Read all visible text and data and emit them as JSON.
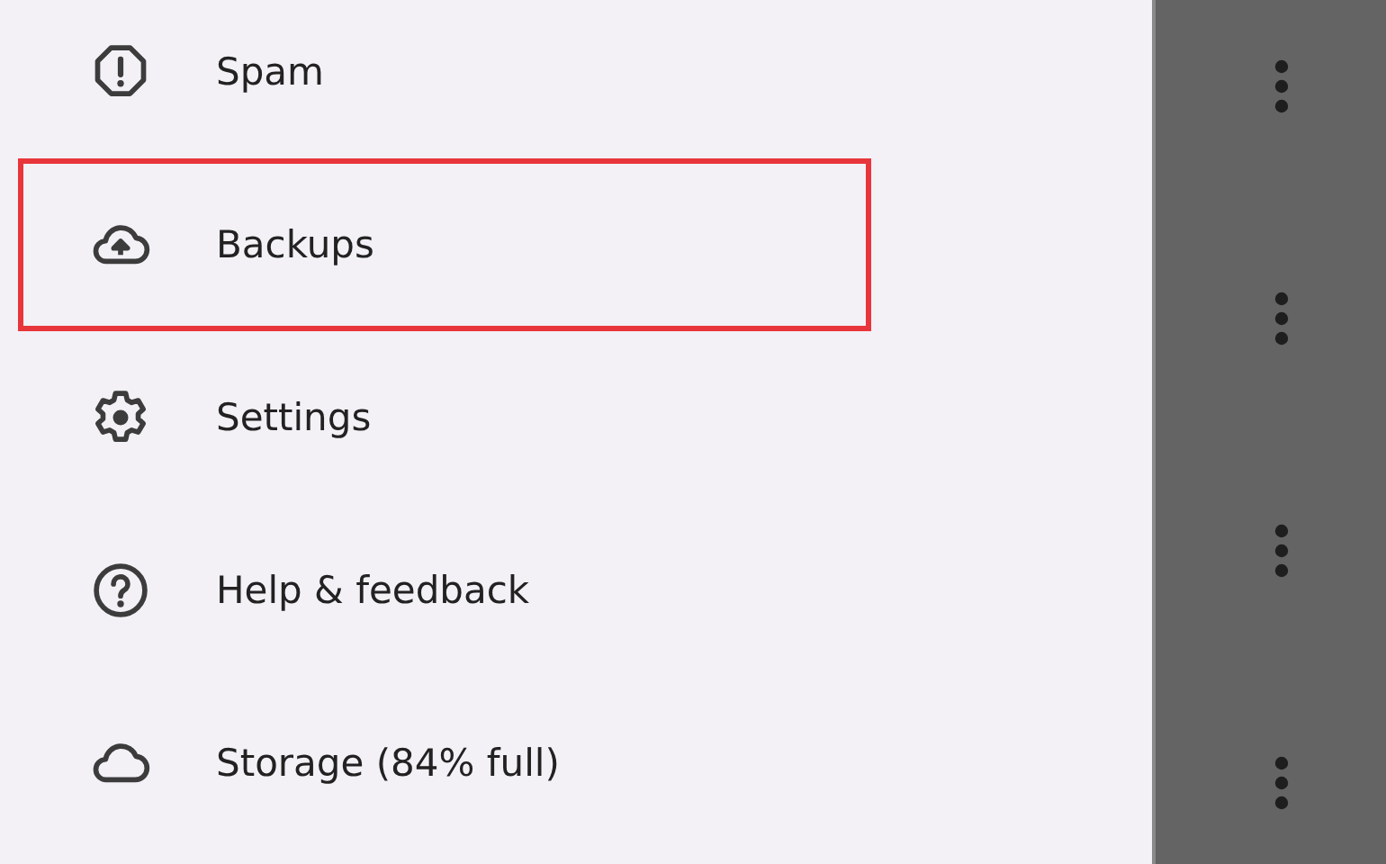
{
  "drawer": {
    "items": [
      {
        "label": "Spam",
        "kind": "spam",
        "highlighted": false
      },
      {
        "label": "Backups",
        "kind": "backup",
        "highlighted": true
      },
      {
        "label": "Settings",
        "kind": "settings",
        "highlighted": false
      },
      {
        "label": "Help & feedback",
        "kind": "help",
        "highlighted": false
      },
      {
        "label": "Storage (84% full)",
        "kind": "storage",
        "highlighted": false
      }
    ]
  }
}
